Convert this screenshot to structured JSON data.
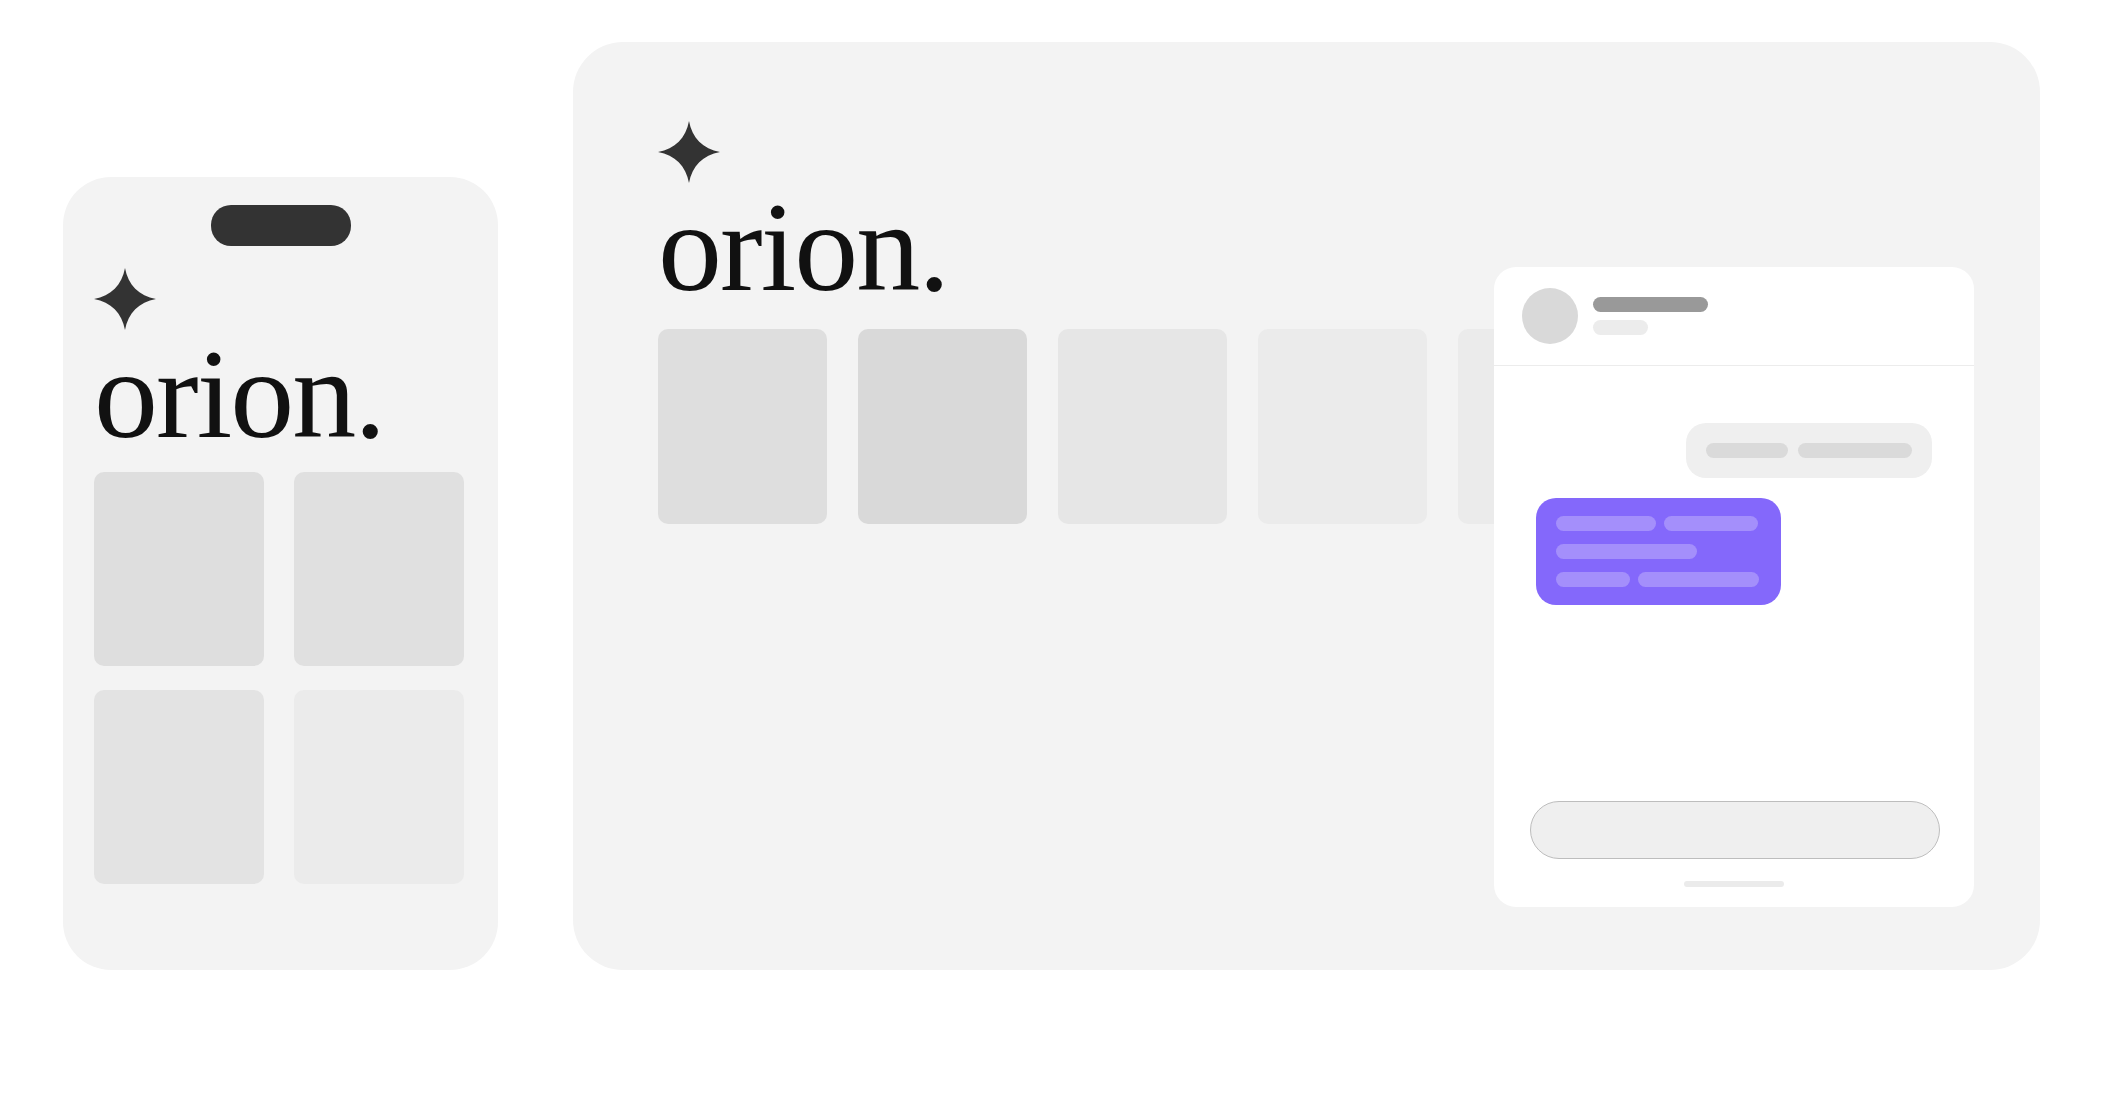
{
  "phone": {
    "logo": "orion."
  },
  "desktop": {
    "logo": "orion."
  }
}
